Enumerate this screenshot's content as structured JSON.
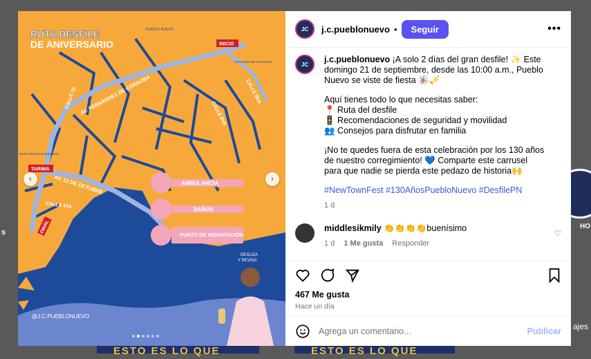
{
  "background": {
    "strip_text": "ESTO ES LO QUE",
    "side_text_left": "s",
    "side_text_right_1": "HO",
    "side_text_right_2": "ajes"
  },
  "post_image": {
    "title_line1": "RUTA DESFILE",
    "title_line2": "DE ANIVERSARIO",
    "brand_tag": "PUEBLO NUEVO",
    "labels": {
      "inicio": "INICIO",
      "estacion": "ESTACIÓN DE GASOLINA",
      "tarima": "TARIMA",
      "final": "FINAL",
      "estacion_bomberos": "ESTACIÓN DE BOMBEROS",
      "calle15": "CALLE 15",
      "fernandez": "AV. FERNÁNDEZ DE CÓRDOBA",
      "calle9na": "CALLE 9NA",
      "calle8va": "CALLE 8VA",
      "av12": "AV. 12 DE OCTUBRE",
      "calle4ta": "CALLE 4TA"
    },
    "legend": [
      "AMBULANCIA",
      "BAÑOS",
      "PUNTO DE HIDRATACIÓN"
    ],
    "swipe_hint_1": "DESLIZA",
    "swipe_hint_2": "Y REVISA",
    "handle": "@J.C.PUEBLONUEVO",
    "slides_total": 6,
    "slide_active": 2
  },
  "header": {
    "username": "j.c.pueblonuevo",
    "separator": "•",
    "follow_label": "Seguir",
    "more_label": "•••"
  },
  "caption": {
    "username": "j.c.pueblonuevo",
    "p1": "¡A solo 2 días del gran desfile! ✨ Este domingo 21 de septiembre, desde las 10:00 a.m., Pueblo Nuevo se viste de fiesta 🪅🎺",
    "p2_intro": "Aquí tienes todo lo que necesitas saber:",
    "p2_item1": "📍 Ruta del desfile",
    "p2_item2": "🚦 Recomendaciones de seguridad y movilidad",
    "p2_item3": "👥 Consejos para disfrutar en familia",
    "p3": "¡No te quedes fuera de esta celebración por los 130 años de nuestro corregimiento! 💙 Comparte este carrusel para que nadie se pierda este pedazo de historia🙌",
    "tags": "#NewTownFest #130AñosPuebloNuevo #DesfilePN",
    "time": "1 d"
  },
  "comment": {
    "username": "middlesikmily",
    "text": "👏👏👏👏buenísimo",
    "time": "1 d",
    "likes": "1 Me gusta",
    "reply": "Responder"
  },
  "actions": {
    "likes": "467 Me gusta",
    "time": "Hace un día"
  },
  "footer": {
    "placeholder": "Agrega un comentario...",
    "publish": "Publicar"
  }
}
